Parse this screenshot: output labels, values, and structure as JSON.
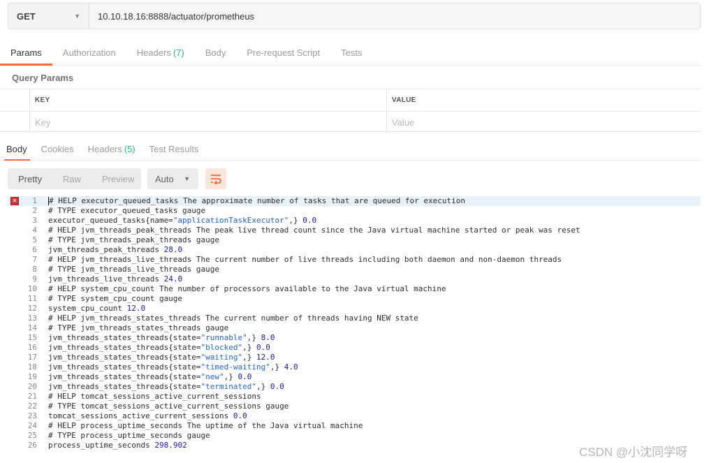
{
  "request": {
    "method": "GET",
    "url": "10.10.18.16:8888/actuator/prometheus"
  },
  "request_tabs": [
    {
      "label": "Params",
      "count": ""
    },
    {
      "label": "Authorization",
      "count": ""
    },
    {
      "label": "Headers",
      "count": "(7)"
    },
    {
      "label": "Body",
      "count": ""
    },
    {
      "label": "Pre-request Script",
      "count": ""
    },
    {
      "label": "Tests",
      "count": ""
    }
  ],
  "query_params": {
    "title": "Query Params",
    "key_header": "KEY",
    "value_header": "VALUE",
    "key_placeholder": "Key",
    "value_placeholder": "Value"
  },
  "response_tabs": [
    {
      "label": "Body",
      "count": ""
    },
    {
      "label": "Cookies",
      "count": ""
    },
    {
      "label": "Headers",
      "count": "(5)"
    },
    {
      "label": "Test Results",
      "count": ""
    }
  ],
  "toolbar": {
    "views": [
      "Pretty",
      "Raw",
      "Preview"
    ],
    "format": "Auto"
  },
  "code_lines": [
    "# HELP executor_queued_tasks The approximate number of tasks that are queued for execution",
    "# TYPE executor_queued_tasks gauge",
    "executor_queued_tasks{name=\"applicationTaskExecutor\",} 0.0",
    "# HELP jvm_threads_peak_threads The peak live thread count since the Java virtual machine started or peak was reset",
    "# TYPE jvm_threads_peak_threads gauge",
    "jvm_threads_peak_threads 28.0",
    "# HELP jvm_threads_live_threads The current number of live threads including both daemon and non-daemon threads",
    "# TYPE jvm_threads_live_threads gauge",
    "jvm_threads_live_threads 24.0",
    "# HELP system_cpu_count The number of processors available to the Java virtual machine",
    "# TYPE system_cpu_count gauge",
    "system_cpu_count 12.0",
    "# HELP jvm_threads_states_threads The current number of threads having NEW state",
    "# TYPE jvm_threads_states_threads gauge",
    "jvm_threads_states_threads{state=\"runnable\",} 8.0",
    "jvm_threads_states_threads{state=\"blocked\",} 0.0",
    "jvm_threads_states_threads{state=\"waiting\",} 12.0",
    "jvm_threads_states_threads{state=\"timed-waiting\",} 4.0",
    "jvm_threads_states_threads{state=\"new\",} 0.0",
    "jvm_threads_states_threads{state=\"terminated\",} 0.0",
    "# HELP tomcat_sessions_active_current_sessions",
    "# TYPE tomcat_sessions_active_current_sessions gauge",
    "tomcat_sessions_active_current_sessions 0.0",
    "# HELP process_uptime_seconds The uptime of the Java virtual machine",
    "# TYPE process_uptime_seconds gauge",
    "process_uptime_seconds 298.902"
  ],
  "watermark": "CSDN @小沈同学呀"
}
